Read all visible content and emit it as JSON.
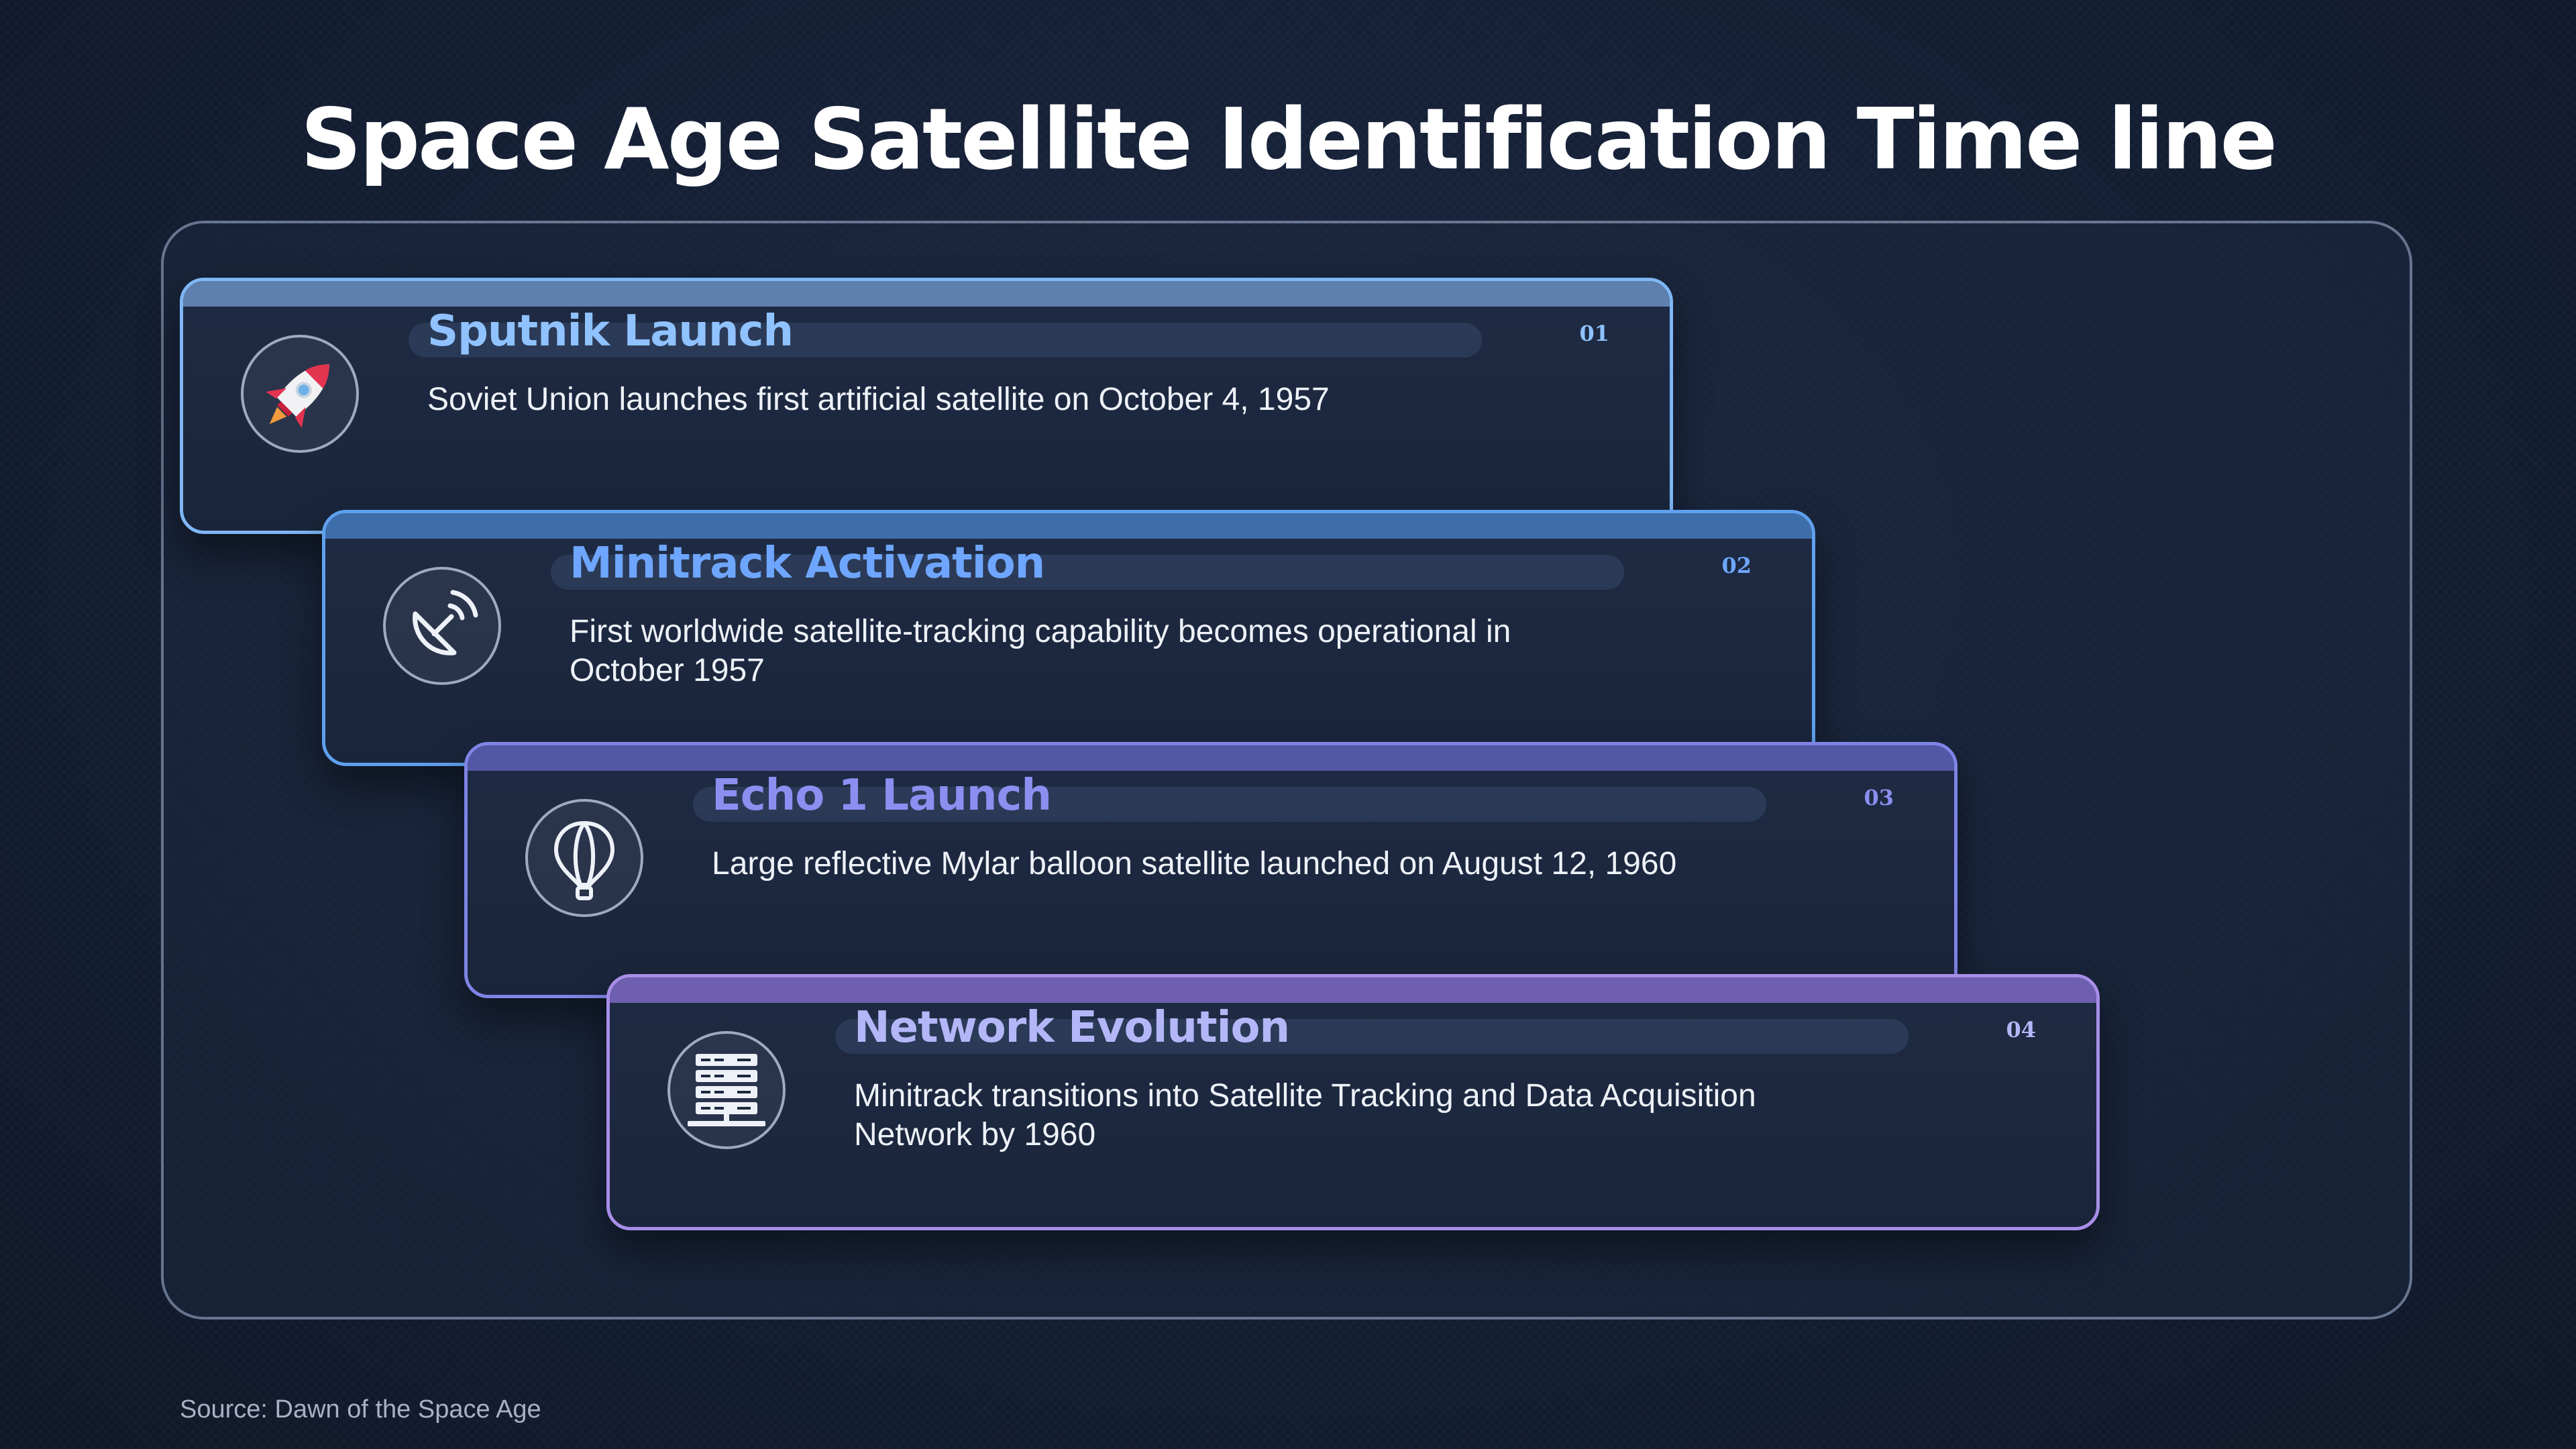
{
  "title": "Space Age Satellite Identification Time line",
  "source": "Source: Dawn of the Space Age",
  "events": [
    {
      "number": "01",
      "title": "Sputnik Launch",
      "description": "Soviet Union launches first artificial satellite on October 4, 1957",
      "icon": "rocket-icon",
      "accent": "#8fc2ff",
      "border": "#7fb6f5",
      "bar": "#5f7fae"
    },
    {
      "number": "02",
      "title": "Minitrack Activation",
      "description": "First worldwide satellite-tracking capability becomes operational in October 1957",
      "icon": "satellite-dish-icon",
      "accent": "#6ea6ff",
      "border": "#5fa0ee",
      "bar": "#3e6eaa"
    },
    {
      "number": "03",
      "title": "Echo 1 Launch",
      "description": "Large reflective Mylar balloon satellite launched on August 12, 1960",
      "icon": "balloon-icon",
      "accent": "#8b8ff0",
      "border": "#7f84e6",
      "bar": "#5258a6"
    },
    {
      "number": "04",
      "title": "Network Evolution",
      "description": "Minitrack transitions into Satellite Tracking and Data Acquisition Network by 1960",
      "icon": "server-icon",
      "accent": "#b3b7f8",
      "border": "#a88ee8",
      "bar": "#6e5fb0"
    }
  ]
}
